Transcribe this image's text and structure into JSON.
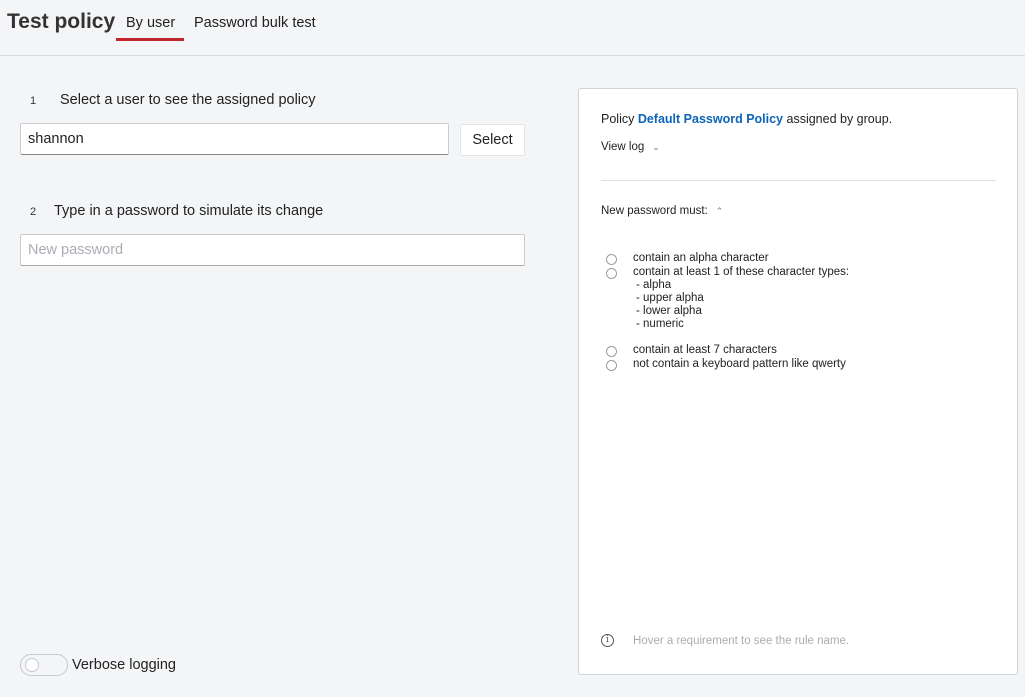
{
  "header": {
    "title": "Test policy",
    "tabs": [
      {
        "label": "By user",
        "active": true
      },
      {
        "label": "Password bulk test",
        "active": false
      }
    ],
    "active_tab_color": "#c0272d"
  },
  "steps": [
    {
      "number": "1",
      "label": "Select a user to see the assigned policy"
    },
    {
      "number": "2",
      "label": "Type in a password to simulate its change"
    }
  ],
  "user_input": {
    "value": "shannon",
    "placeholder": ""
  },
  "select_button": {
    "label": "Select"
  },
  "password_input": {
    "value": "",
    "placeholder": "New password"
  },
  "verbose": {
    "label": "Verbose logging",
    "enabled": false
  },
  "panel": {
    "policy_prefix": "Policy",
    "policy_name": "Default Password Policy",
    "policy_suffix": "assigned by group.",
    "link_color": "#0b64b8",
    "view_log": "View log",
    "view_log_icon": "chevron-down-icon",
    "must_label": "New password must:",
    "must_icon": "chevron-up-icon",
    "rules": [
      {
        "text": "contain an alpha character"
      },
      {
        "text": "contain at least 1 of these character types:",
        "subitems": [
          "- alpha",
          "- upper alpha",
          "- lower alpha",
          "- numeric"
        ]
      },
      {
        "text": "contain at least 7 characters"
      },
      {
        "text": "not contain a keyboard pattern like qwerty"
      }
    ],
    "hint": "Hover a requirement to see the rule name.",
    "hint_icon": "info-icon"
  }
}
